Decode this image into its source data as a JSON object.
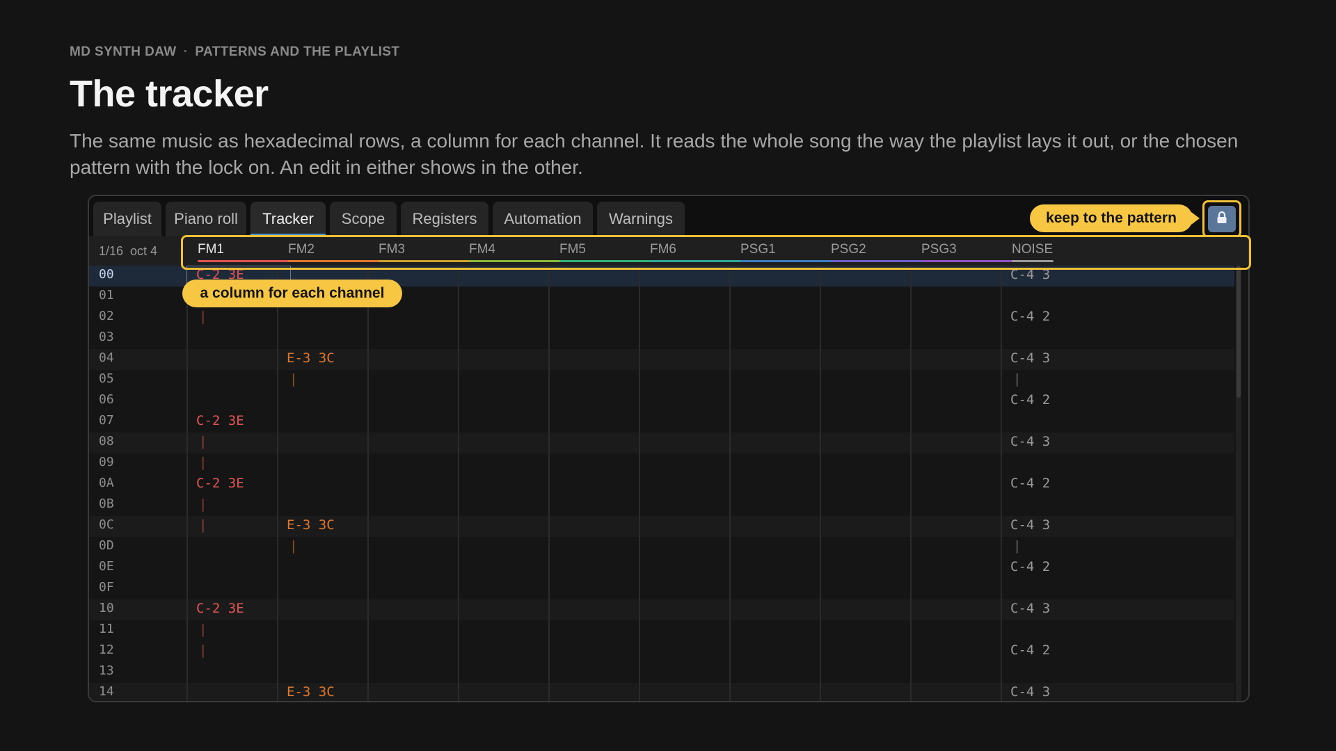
{
  "page": {
    "kicker_app": "MD SYNTH DAW",
    "kicker_section": "PATTERNS AND THE PLAYLIST",
    "title": "The tracker",
    "description": "The same music as hexadecimal rows, a column for each channel. It reads the whole song the way the playlist lays it out, or the chosen pattern with the lock on. An edit in either shows in the other."
  },
  "tabs": [
    {
      "label": "Playlist",
      "active": false
    },
    {
      "label": "Piano roll",
      "active": false
    },
    {
      "label": "Tracker",
      "active": true
    },
    {
      "label": "Scope",
      "active": false
    },
    {
      "label": "Registers",
      "active": false
    },
    {
      "label": "Automation",
      "active": false
    },
    {
      "label": "Warnings",
      "active": false
    }
  ],
  "callouts": {
    "lock": "keep to the pattern",
    "channels": "a column for each channel"
  },
  "status": {
    "step": "1/16",
    "octave": "oct 4"
  },
  "channels": [
    {
      "name": "FM1",
      "color": "#e05252"
    },
    {
      "name": "FM2",
      "color": "#e0742e"
    },
    {
      "name": "FM3",
      "color": "#c9a227"
    },
    {
      "name": "FM4",
      "color": "#8ab83a"
    },
    {
      "name": "FM5",
      "color": "#33b07a"
    },
    {
      "name": "FM6",
      "color": "#2fa89a"
    },
    {
      "name": "PSG1",
      "color": "#3a7fc0"
    },
    {
      "name": "PSG2",
      "color": "#6a5ec9"
    },
    {
      "name": "PSG3",
      "color": "#8e52c2"
    },
    {
      "name": "NOISE",
      "color": "#9a9a9a"
    }
  ],
  "note_colors": {
    "FM1": "#e35454",
    "FM2": "#e0782e",
    "NOISE": "#9a9a9a"
  },
  "rows": [
    {
      "n": "00",
      "FM1": "C-2 3E",
      "FM2": "",
      "NOISE": "C-4 3"
    },
    {
      "n": "01",
      "FM1": "",
      "FM2": "",
      "NOISE": ""
    },
    {
      "n": "02",
      "FM1": "|",
      "FM2": "",
      "NOISE": "C-4 2"
    },
    {
      "n": "03",
      "FM1": "",
      "FM2": "",
      "NOISE": ""
    },
    {
      "n": "04",
      "FM1": "",
      "FM2": "E-3 3C",
      "NOISE": "C-4 3"
    },
    {
      "n": "05",
      "FM1": "",
      "FM2": "|",
      "NOISE": "|"
    },
    {
      "n": "06",
      "FM1": "",
      "FM2": "",
      "NOISE": "C-4 2"
    },
    {
      "n": "07",
      "FM1": "C-2 3E",
      "FM2": "",
      "NOISE": ""
    },
    {
      "n": "08",
      "FM1": "|",
      "FM2": "",
      "NOISE": "C-4 3"
    },
    {
      "n": "09",
      "FM1": "|",
      "FM2": "",
      "NOISE": ""
    },
    {
      "n": "0A",
      "FM1": "C-2 3E",
      "FM2": "",
      "NOISE": "C-4 2"
    },
    {
      "n": "0B",
      "FM1": "|",
      "FM2": "",
      "NOISE": ""
    },
    {
      "n": "0C",
      "FM1": "|",
      "FM2": "E-3 3C",
      "NOISE": "C-4 3"
    },
    {
      "n": "0D",
      "FM1": "",
      "FM2": "|",
      "NOISE": "|"
    },
    {
      "n": "0E",
      "FM1": "",
      "FM2": "",
      "NOISE": "C-4 2"
    },
    {
      "n": "0F",
      "FM1": "",
      "FM2": "",
      "NOISE": ""
    },
    {
      "n": "10",
      "FM1": "C-2 3E",
      "FM2": "",
      "NOISE": "C-4 3"
    },
    {
      "n": "11",
      "FM1": "|",
      "FM2": "",
      "NOISE": ""
    },
    {
      "n": "12",
      "FM1": "|",
      "FM2": "",
      "NOISE": "C-4 2"
    },
    {
      "n": "13",
      "FM1": "",
      "FM2": "",
      "NOISE": ""
    },
    {
      "n": "14",
      "FM1": "",
      "FM2": "E-3 3C",
      "NOISE": "C-4 3"
    }
  ],
  "selected_row": "00",
  "icons": {
    "lock": "lock-icon"
  }
}
